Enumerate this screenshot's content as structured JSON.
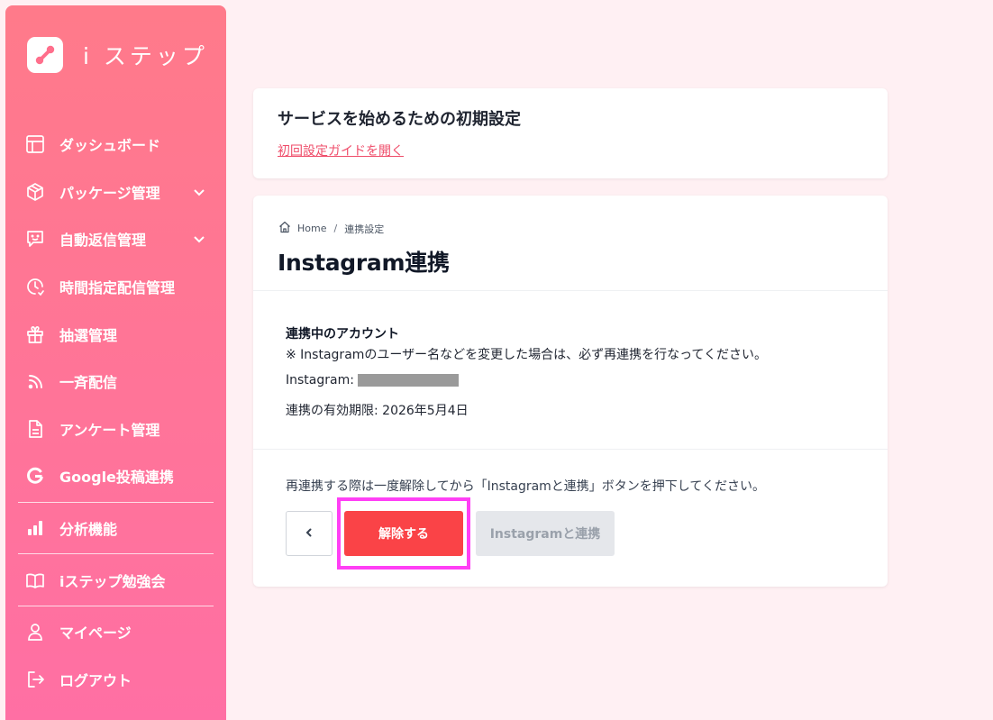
{
  "brand": {
    "name": "i ステップ",
    "logo_icon": "link-chain-icon"
  },
  "sidebar": {
    "items": [
      {
        "label": "ダッシュボード",
        "icon": "layout-icon"
      },
      {
        "label": "パッケージ管理",
        "icon": "package-icon",
        "expandable": true
      },
      {
        "label": "自動返信管理",
        "icon": "chat-reply-icon",
        "expandable": true
      },
      {
        "label": "時間指定配信管理",
        "icon": "clock-icon"
      },
      {
        "label": "抽選管理",
        "icon": "gift-icon"
      },
      {
        "label": "一斉配信",
        "icon": "rss-icon"
      },
      {
        "label": "アンケート管理",
        "icon": "document-icon"
      },
      {
        "label": "Google投稿連携",
        "icon": "google-icon"
      },
      {
        "label": "分析機能",
        "icon": "bar-chart-icon"
      },
      {
        "label": "iステップ勉強会",
        "icon": "book-icon"
      },
      {
        "label": "マイページ",
        "icon": "user-icon"
      },
      {
        "label": "ログアウト",
        "icon": "logout-icon"
      }
    ]
  },
  "setup": {
    "title": "サービスを始めるための初期設定",
    "guide_link": "初回設定ガイドを開く"
  },
  "breadcrumb": {
    "home": "Home",
    "separator": "/",
    "current": "連携設定"
  },
  "page": {
    "title": "Instagram連携"
  },
  "account": {
    "heading": "連携中のアカウント",
    "note": "※ Instagramのユーザー名などを変更した場合は、必ず再連携を行なってください。",
    "instagram_label": "Instagram:",
    "expiry": "連携の有効期限: 2026年5月4日"
  },
  "relink": {
    "note": "再連携する際は一度解除してから「Instagramと連携」ボタンを押下してください。",
    "back_icon": "chevron-left-icon",
    "release_label": "解除する",
    "link_label": "Instagramと連携"
  },
  "colors": {
    "sidebar_top": "#ff7a8a",
    "sidebar_bottom": "#ff6fa4",
    "danger": "#fa4347",
    "link": "#ef4d6a",
    "highlight": "#ff3ff5",
    "background": "#fff0f3"
  }
}
